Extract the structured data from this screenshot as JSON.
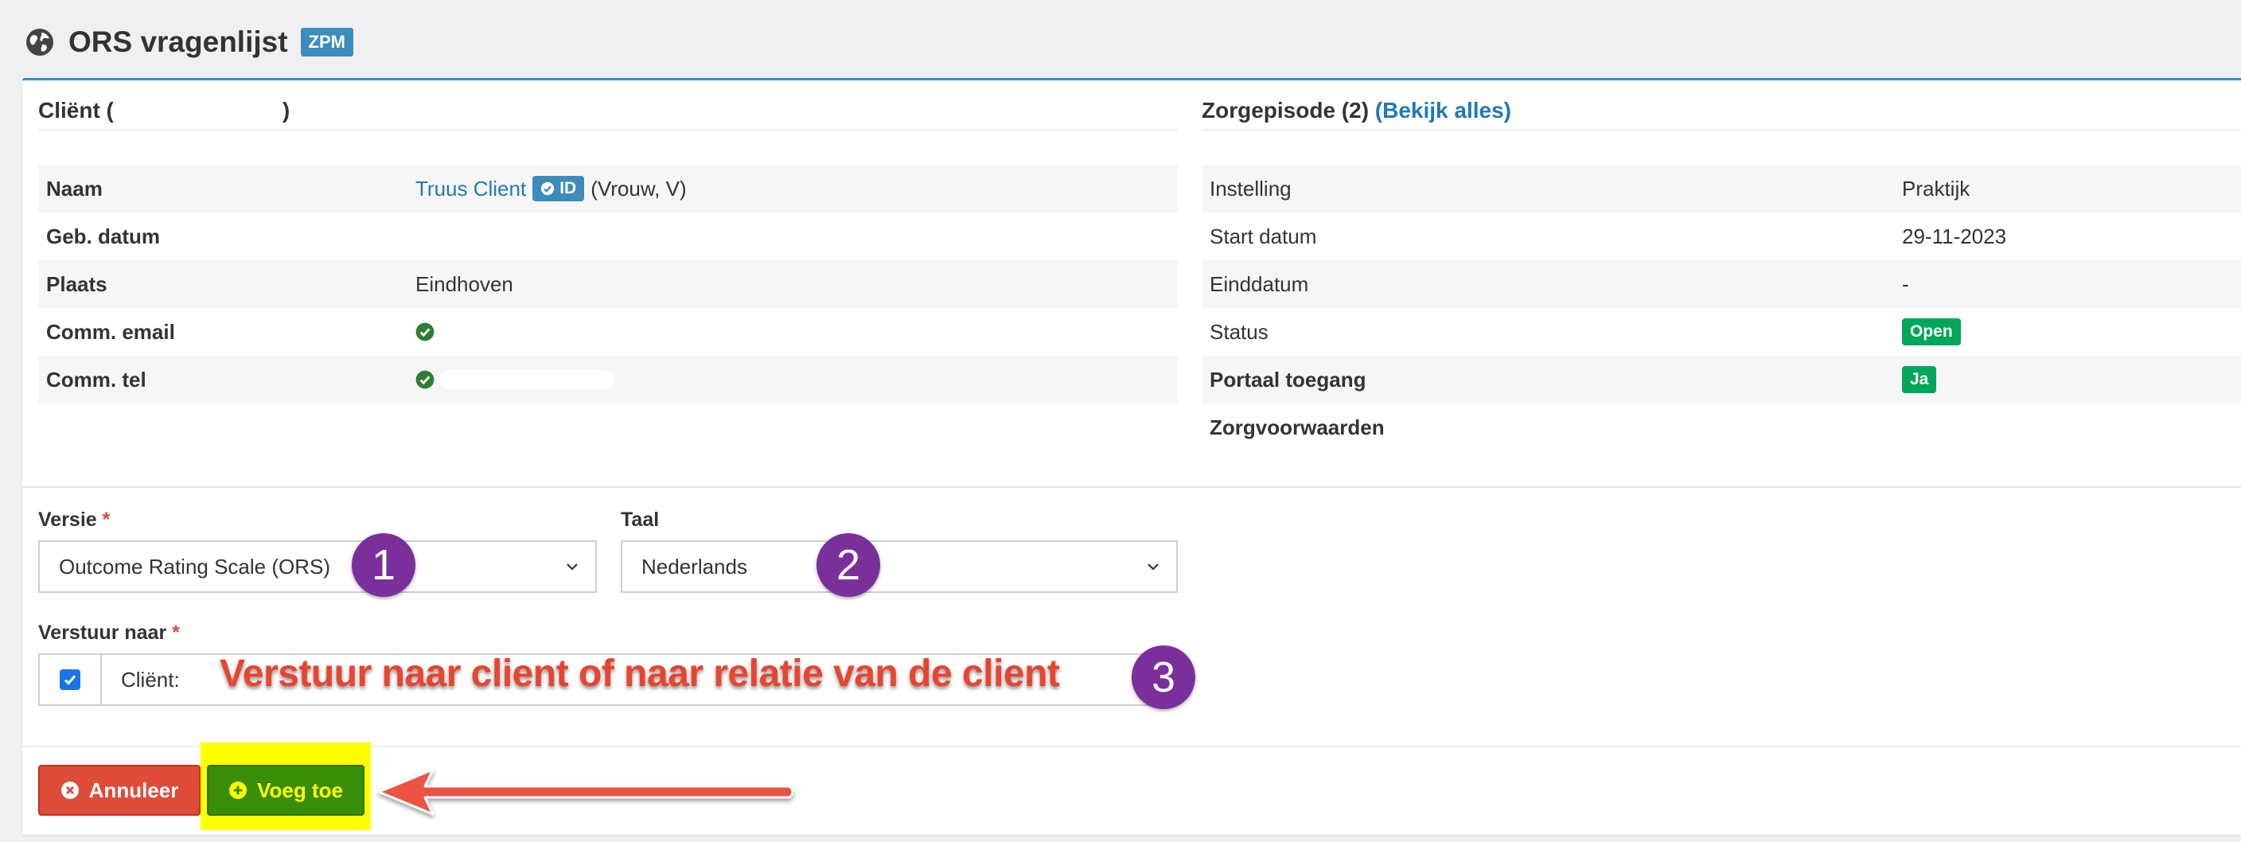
{
  "header": {
    "title": "ORS vragenlijst",
    "badge": "ZPM"
  },
  "client": {
    "title_prefix": "Cliënt (",
    "title_suffix": ")",
    "rows": {
      "naam": {
        "label": "Naam",
        "name": "Truus Client",
        "id_badge": "ID",
        "extra": "(Vrouw, V)"
      },
      "geb": {
        "label": "Geb. datum",
        "value": ""
      },
      "plaats": {
        "label": "Plaats",
        "value": "Eindhoven"
      },
      "email": {
        "label": "Comm. email"
      },
      "tel": {
        "label": "Comm. tel"
      }
    }
  },
  "zorg": {
    "title": "Zorgepisode (2)",
    "link": "(Bekijk alles)",
    "rows": {
      "instelling": {
        "label": "Instelling",
        "value": "Praktijk"
      },
      "start": {
        "label": "Start datum",
        "value": "29-11-2023"
      },
      "eind": {
        "label": "Einddatum",
        "value": "-"
      },
      "status": {
        "label": "Status",
        "value": "Open"
      },
      "portaal": {
        "label": "Portaal toegang",
        "value": "Ja"
      },
      "voorwaarden": {
        "label": "Zorgvoorwaarden",
        "value": ""
      }
    }
  },
  "form": {
    "versie": {
      "label": "Versie",
      "required": "*",
      "value": "Outcome Rating Scale (ORS)"
    },
    "taal": {
      "label": "Taal",
      "value": "Nederlands"
    },
    "verstuur": {
      "label": "Verstuur naar",
      "required": "*",
      "field_label": "Cliënt:"
    }
  },
  "annotations": {
    "num1": "1",
    "num2": "2",
    "num3": "3",
    "text": "Verstuur naar client of naar relatie van de client"
  },
  "buttons": {
    "cancel": "Annuleer",
    "add": "Voeg toe"
  },
  "colors": {
    "primary": "#3c8dbc",
    "danger": "#dd4b39",
    "success": "#00a65a",
    "add_button": "#3a8d07",
    "highlight": "#ffff00",
    "annotation_purple": "#7b2f9b",
    "annotation_red": "#e8452f"
  }
}
